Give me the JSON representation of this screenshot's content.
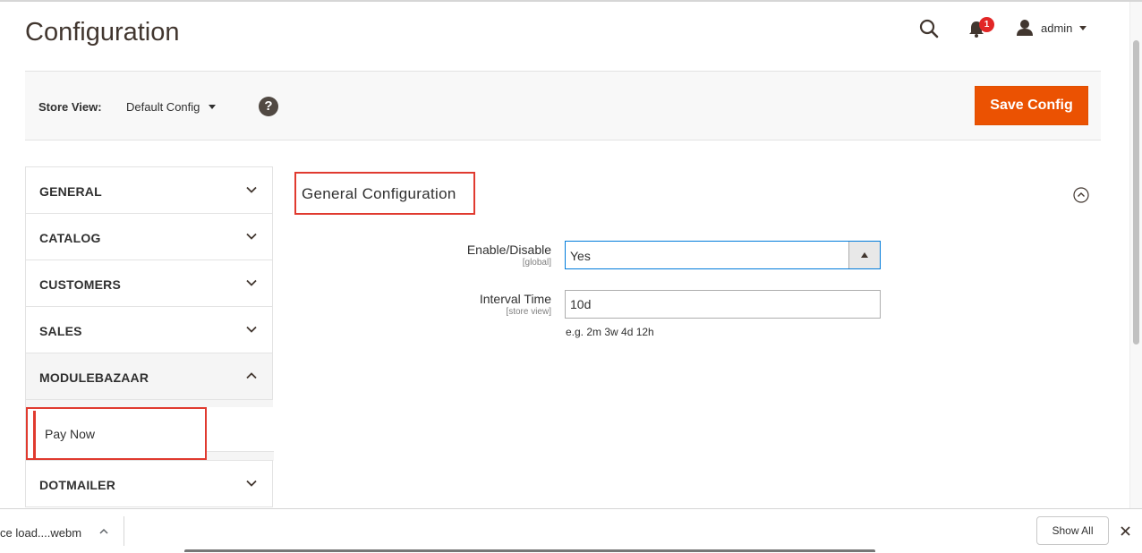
{
  "page": {
    "title": "Configuration"
  },
  "header": {
    "search_icon": "search-icon",
    "notification_count": "1",
    "user_name": "admin"
  },
  "store_bar": {
    "label": "Store View:",
    "selected": "Default Config",
    "help": "?",
    "save_label": "Save Config"
  },
  "sidebar": {
    "items": [
      {
        "label": "GENERAL",
        "expanded": false
      },
      {
        "label": "CATALOG",
        "expanded": false
      },
      {
        "label": "CUSTOMERS",
        "expanded": false
      },
      {
        "label": "SALES",
        "expanded": false
      },
      {
        "label": "MODULEBAZAAR",
        "expanded": true
      },
      {
        "label": "DOTMAILER",
        "expanded": false
      }
    ],
    "subitems": [
      {
        "label": "Pay Now"
      }
    ]
  },
  "section": {
    "title": "General Configuration",
    "fields": [
      {
        "label": "Enable/Disable",
        "scope": "[global]",
        "value": "Yes"
      },
      {
        "label": "Interval Time",
        "scope": "[store view]",
        "value": "10d",
        "note": "e.g. 2m 3w 4d 12h"
      }
    ]
  },
  "download_bar": {
    "file_name": "ce load....webm",
    "show_all_label": "Show All"
  },
  "colors": {
    "accent": "#eb5202",
    "highlight": "#e03a2f",
    "focus": "#007bdb"
  }
}
